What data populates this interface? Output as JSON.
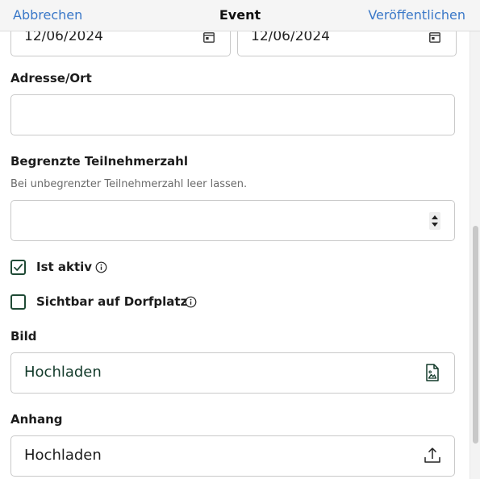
{
  "navbar": {
    "cancel_label": "Abbrechen",
    "title": "Event",
    "publish_label": "Veröffentlichen"
  },
  "dates": {
    "start_value": "12/06/2024",
    "end_value": "12/06/2024"
  },
  "address": {
    "label": "Adresse/Ort",
    "value": ""
  },
  "participants": {
    "label": "Begrenzte Teilnehmerzahl",
    "hint": "Bei unbegrenzter Teilnehmerzahl leer lassen.",
    "value": ""
  },
  "active": {
    "label": "Ist aktiv",
    "checked": true
  },
  "visible": {
    "label": "Sichtbar auf Dorfplatz",
    "checked": false
  },
  "image": {
    "label": "Bild",
    "upload_label": "Hochladen"
  },
  "attachment": {
    "label": "Anhang",
    "upload_label": "Hochladen"
  },
  "colors": {
    "link": "#3a78c8",
    "checkbox": "#1f4a35",
    "upload_text": "#123a2a"
  },
  "icons": {
    "date": "calendar-icon",
    "info": "info-circle-icon",
    "image_upload": "image-file-icon",
    "attachment_upload": "upload-tray-icon",
    "stepper": "stepper-arrows-icon"
  }
}
